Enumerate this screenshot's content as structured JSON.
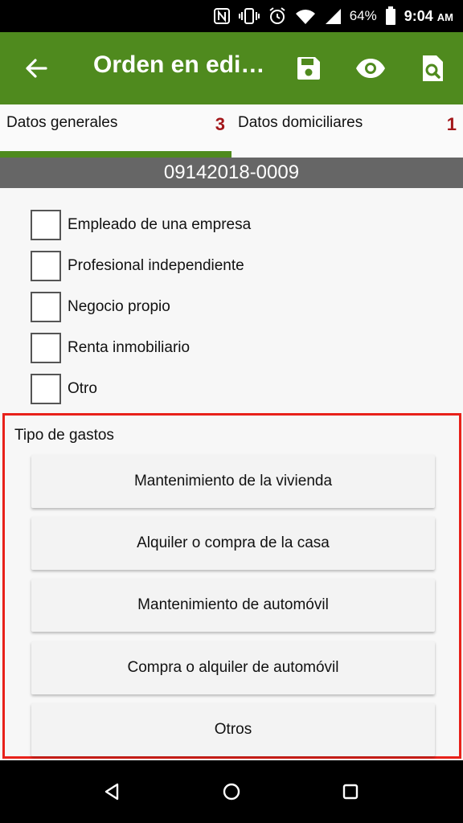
{
  "status_bar": {
    "battery_percent": "64%",
    "time": "9:04",
    "time_suffix": "AM"
  },
  "app_bar": {
    "title": "Orden en edi…"
  },
  "tabs": [
    {
      "label": "Datos generales",
      "count": "3"
    },
    {
      "label": "Datos domiciliares",
      "count": "1"
    }
  ],
  "order_number": "09142018-0009",
  "checkboxes": [
    {
      "label": "Empleado de una empresa"
    },
    {
      "label": "Profesional independiente"
    },
    {
      "label": "Negocio propio"
    },
    {
      "label": "Renta inmobiliario"
    },
    {
      "label": "Otro"
    }
  ],
  "gastos": {
    "title": "Tipo de gastos",
    "buttons": [
      {
        "label": "Mantenimiento de la vivienda"
      },
      {
        "label": "Alquiler o compra de la casa"
      },
      {
        "label": "Mantenimiento de automóvil"
      },
      {
        "label": "Compra o alquiler de automóvil"
      },
      {
        "label": "Otros"
      }
    ]
  },
  "colors": {
    "app_bar": "#4f8a1e",
    "tab_count": "#a3171a",
    "highlight_border": "#e8211a",
    "order_bar": "#666666"
  }
}
